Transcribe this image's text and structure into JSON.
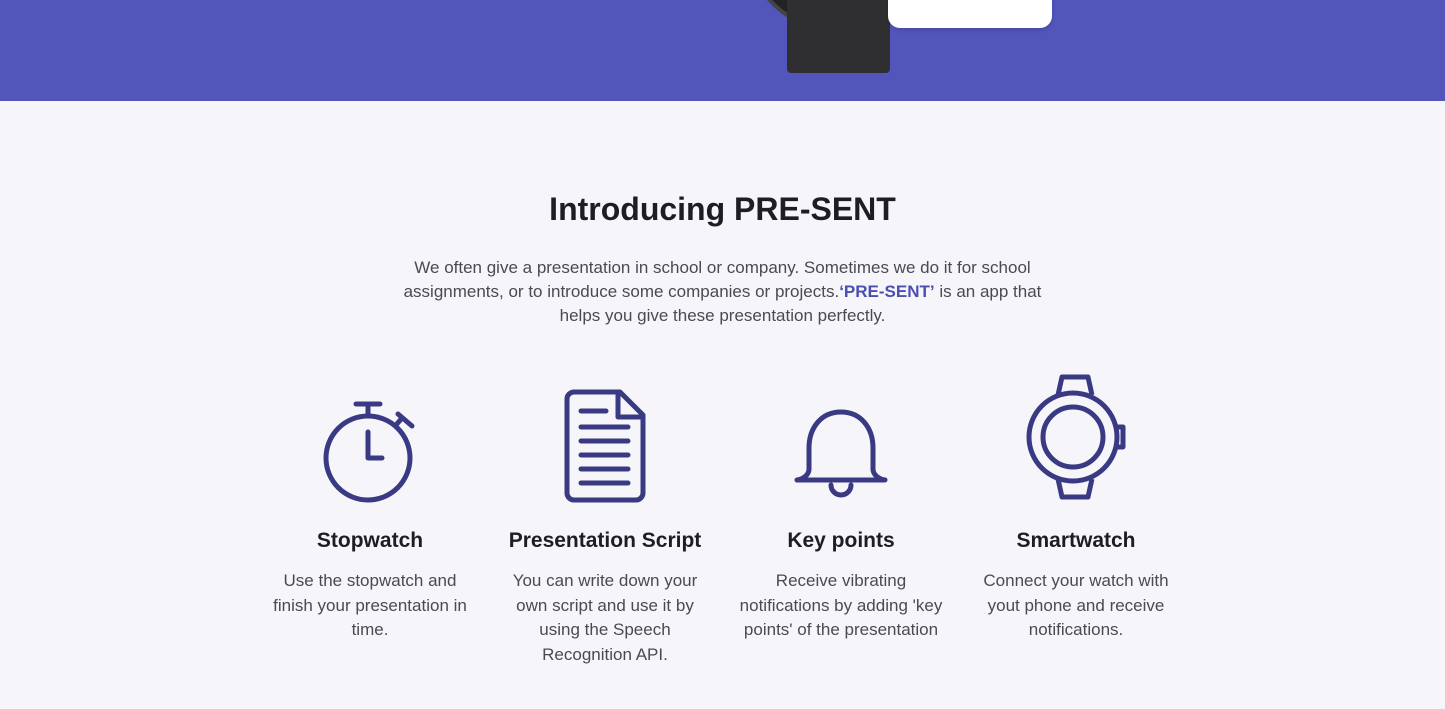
{
  "hero": {
    "background": "#5256bb",
    "illustration": "smartwatch-and-phone"
  },
  "intro": {
    "title": "Introducing PRE-SENT",
    "text_before": "We often give a presentation in school or company. Sometimes we do it for school assignments, or to introduce some companies or projects.",
    "brand": "‘PRE-SENT’",
    "text_after": " is an app that helps you give these presentation perfectly."
  },
  "accent_color": "#3a3a84",
  "features": [
    {
      "icon": "stopwatch-icon",
      "title": "Stopwatch",
      "description": "Use the stopwatch and finish your presentation in time."
    },
    {
      "icon": "document-icon",
      "title": "Presentation Script",
      "description": "You can write down your own script and use it by using the Speech Recognition API."
    },
    {
      "icon": "bell-icon",
      "title": "Key points",
      "description": "Receive vibrating notifications by adding 'key points' of the presentation"
    },
    {
      "icon": "smartwatch-icon",
      "title": "Smartwatch",
      "description": "Connect your watch with yout phone and receive notifications."
    }
  ]
}
